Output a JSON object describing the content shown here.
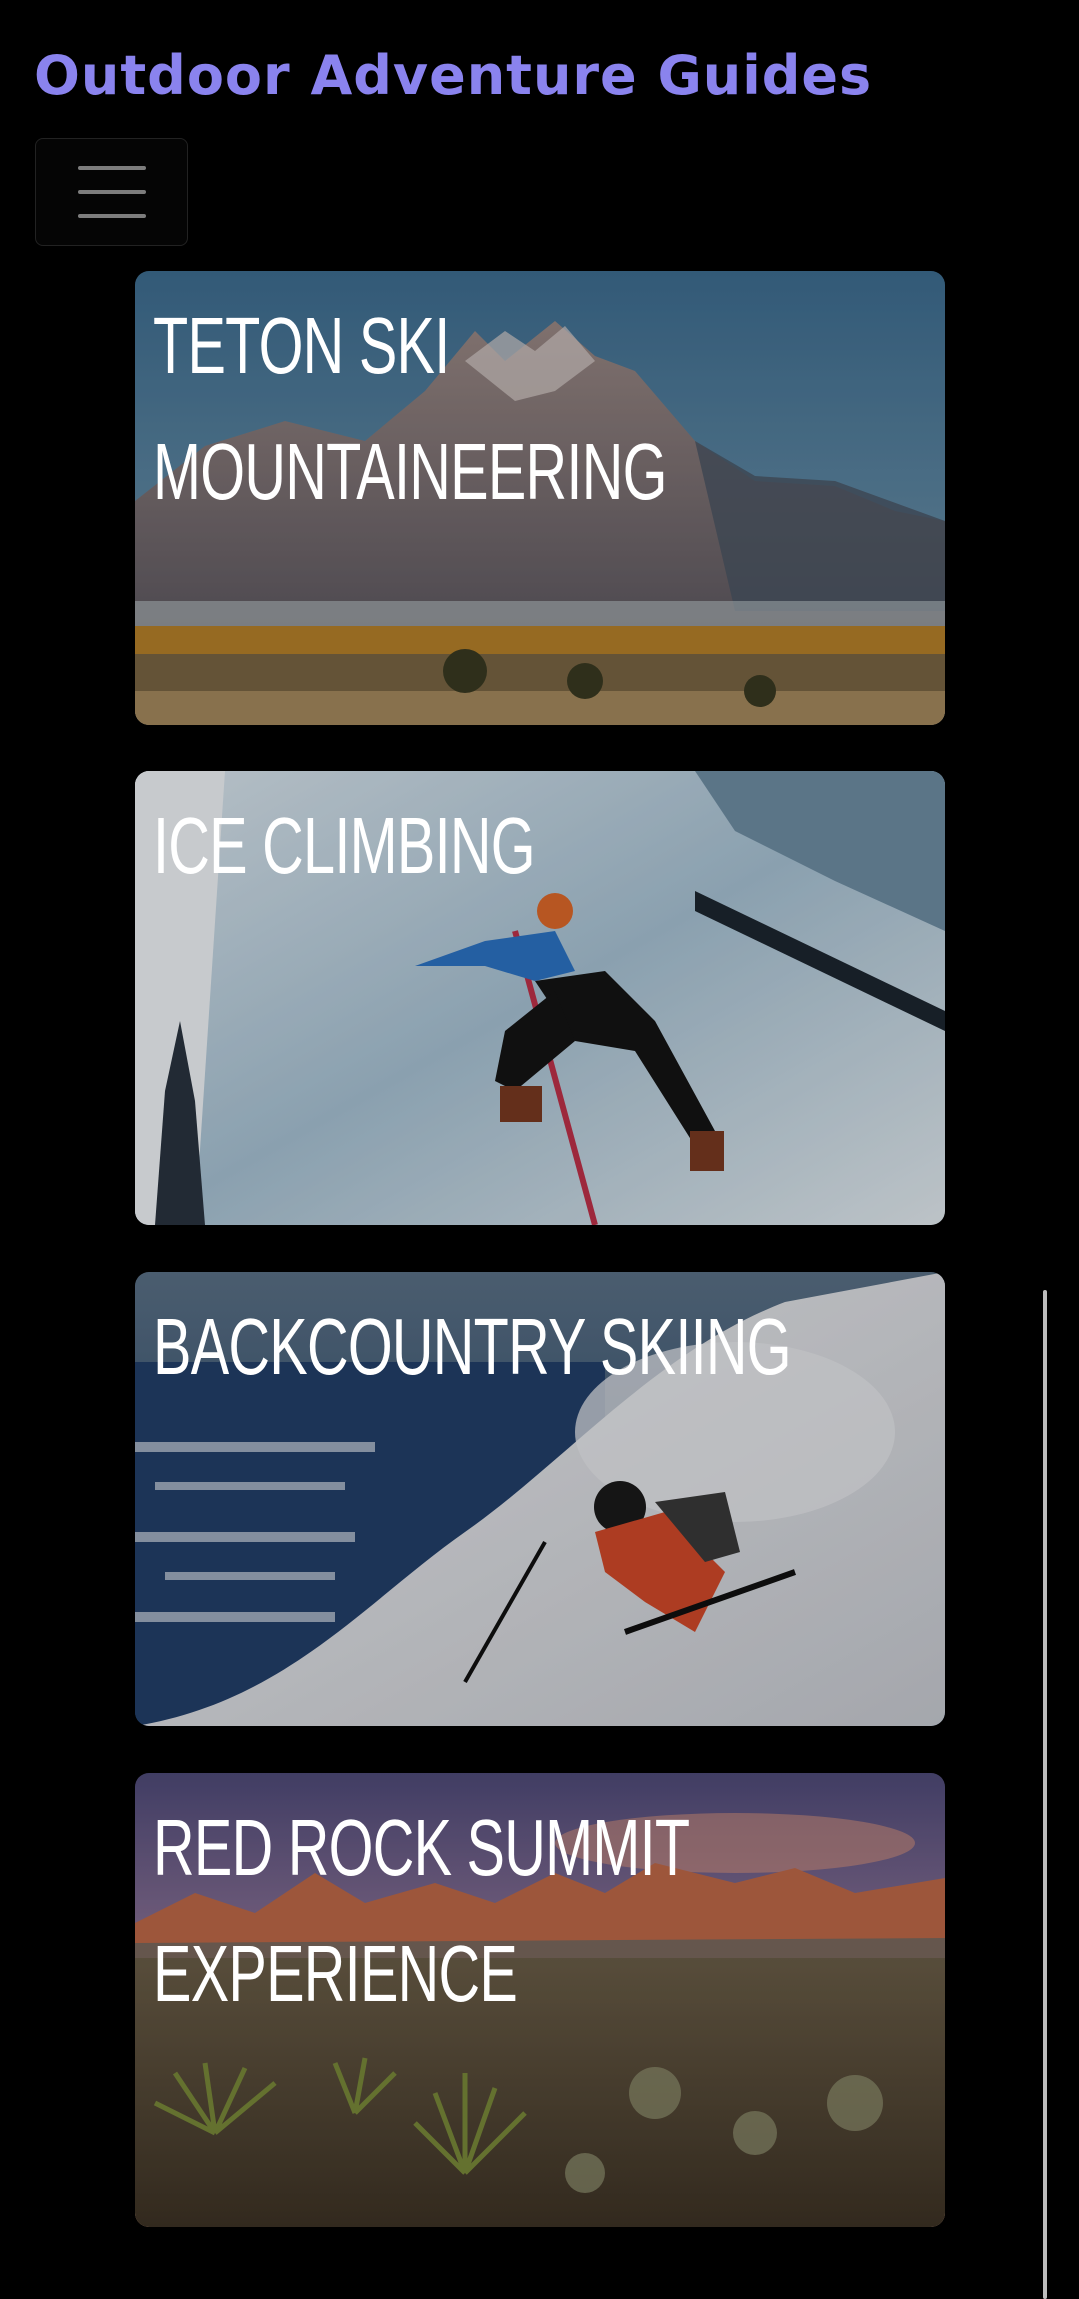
{
  "site": {
    "brand": "Outdoor Adventure Guides",
    "menu_icon": "hamburger-menu-icon"
  },
  "adventures": [
    {
      "title": "TETON SKI MOUNTAINEERING"
    },
    {
      "title": "ICE CLIMBING"
    },
    {
      "title": "BACKCOUNTRY SKIING"
    },
    {
      "title": "RED ROCK SUMMIT EXPERIENCE"
    }
  ],
  "colors": {
    "background": "#000000",
    "brand": "#8a83ee",
    "card_title": "#ffffff"
  }
}
